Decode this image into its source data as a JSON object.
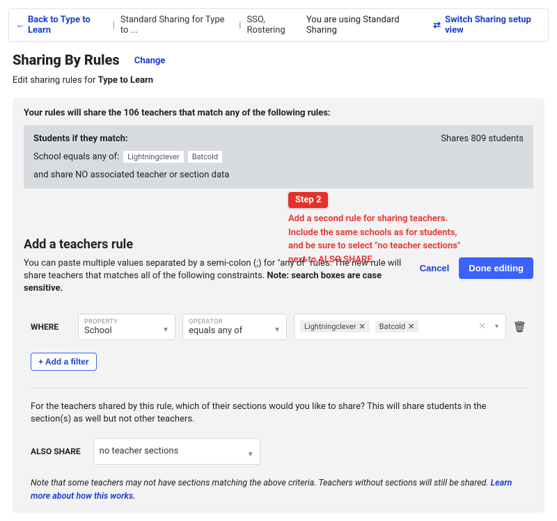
{
  "topbar": {
    "back": "Back to Type to Learn",
    "crumb1": "Standard Sharing for Type to ...",
    "crumb2": "SSO, Rostering",
    "standard": "You are using Standard Sharing",
    "switch": "Switch Sharing setup view"
  },
  "header": {
    "title": "Sharing By Rules",
    "change": "Change",
    "sub_prefix": "Edit sharing rules for ",
    "sub_app": "Type to Learn"
  },
  "panel": {
    "head": "Your rules will share the 106 teachers that match any of the following rules:",
    "rule_title": "Students if they match:",
    "school_prefix": "School equals any of:",
    "chips": [
      "Lightningclever",
      "Batcold"
    ],
    "no_assoc": "and share NO associated teacher or section data",
    "shares": "Shares 809 students"
  },
  "callout": {
    "badge": "Step 2",
    "line1": "Add a second rule for sharing teachers.",
    "line2": "Include the same schools as for students,",
    "line3": "and be sure to select \"no teacher sections\"",
    "line4": "next to ALSO SHARE."
  },
  "teachers": {
    "h2": "Add a teachers rule",
    "desc": "You can paste multiple values separated by a semi-colon (;) for \"any of\" rules. The new rule will share teachers that matches all of the following constraints. ",
    "desc_bold": "Note: search boxes are case sensitive.",
    "cancel": "Cancel",
    "done": "Done editing"
  },
  "filter": {
    "where": "WHERE",
    "prop_label": "PROPERTY",
    "prop_value": "School",
    "op_label": "OPERATOR",
    "op_value": "equals any of",
    "tags": [
      "Lightningclever",
      "Batcold"
    ],
    "add": "+ Add a filter"
  },
  "also": {
    "question": "For the teachers shared by this rule, which of their sections would you like to share? This will share students in the section(s) as well but not other teachers.",
    "label": "ALSO SHARE",
    "value": "no teacher sections",
    "note": "Note that some teachers may not have sections matching the above criteria. Teachers without sections will still be shared. ",
    "link": "Learn more about how this works."
  }
}
